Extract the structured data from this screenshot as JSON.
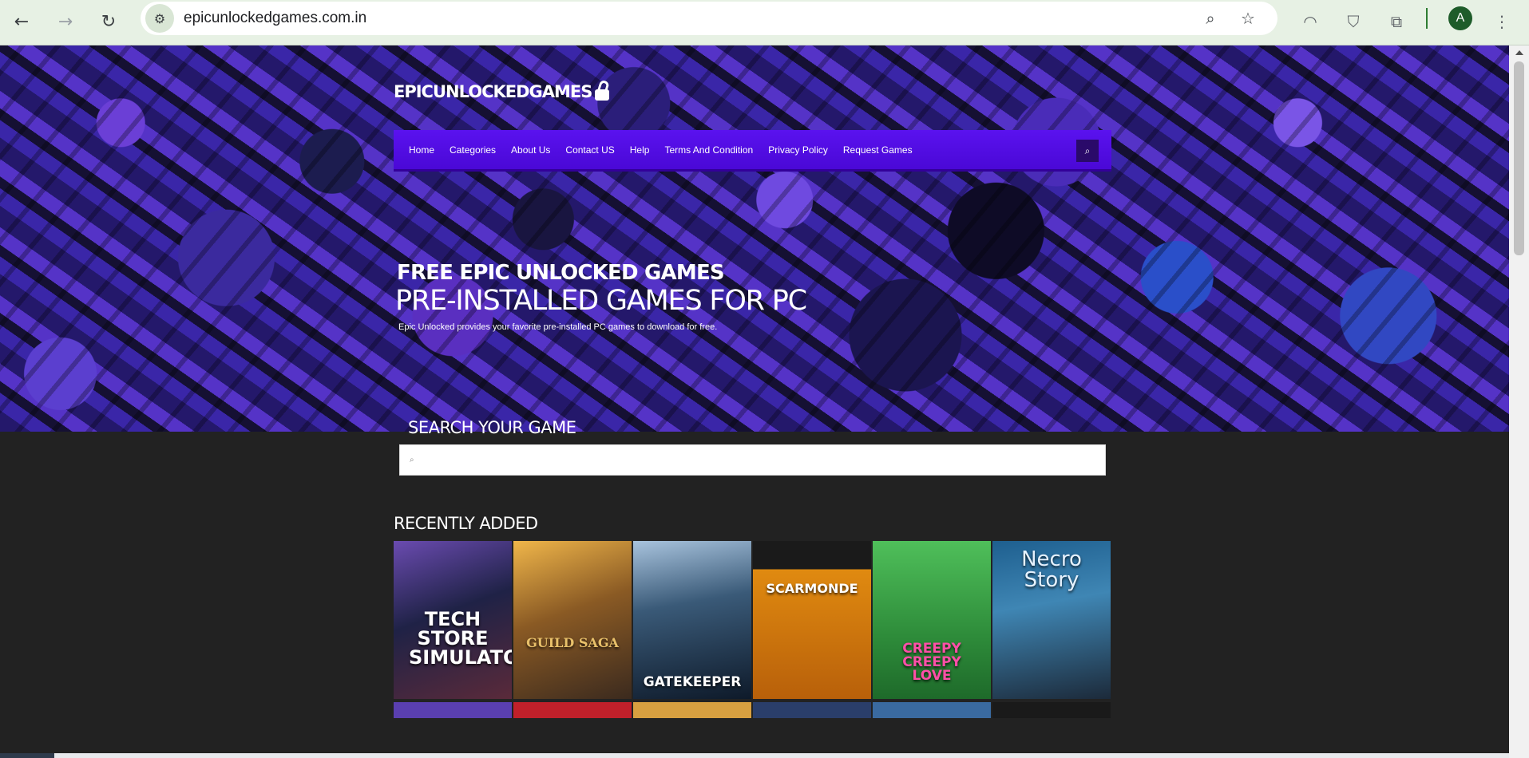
{
  "browser": {
    "url": "epicunlockedgames.com.in",
    "profile_initial": "A"
  },
  "site": {
    "logo_text": "EPICUNLOCKEDGAMES",
    "nav": [
      {
        "label": "Home"
      },
      {
        "label": "Categories"
      },
      {
        "label": "About Us"
      },
      {
        "label": "Contact US"
      },
      {
        "label": "Help"
      },
      {
        "label": "Terms And Condition"
      },
      {
        "label": "Privacy Policy"
      },
      {
        "label": "Request Games"
      }
    ],
    "hero": {
      "title_line1": "FREE EPIC UNLOCKED GAMES",
      "title_line2": "PRE-INSTALLED GAMES FOR PC",
      "description": "Epic Unlocked provides your favorite pre-installed PC games to download for free."
    },
    "search": {
      "heading": "SEARCH YOUR GAME",
      "value": "",
      "placeholder": ""
    },
    "recent": {
      "heading": "RECENTLY ADDED",
      "games": [
        {
          "title": "TECH STORE SIMULATOR",
          "color": "#2a2f5a"
        },
        {
          "title": "GUILD SAGA",
          "color": "#9a6a2a"
        },
        {
          "title": "GATEKEEPER",
          "color": "#2b3e5e"
        },
        {
          "title": "SCARMONDE",
          "color": "#c7730e"
        },
        {
          "title": "CREEPY CREEPY LOVE",
          "color": "#3da64a"
        },
        {
          "title": "Necro Story",
          "color": "#2f6f9a"
        }
      ]
    }
  },
  "colors": {
    "nav_purple": "#5a12ef",
    "page_bg": "#222222",
    "chrome_bg": "#e7f1e4"
  }
}
